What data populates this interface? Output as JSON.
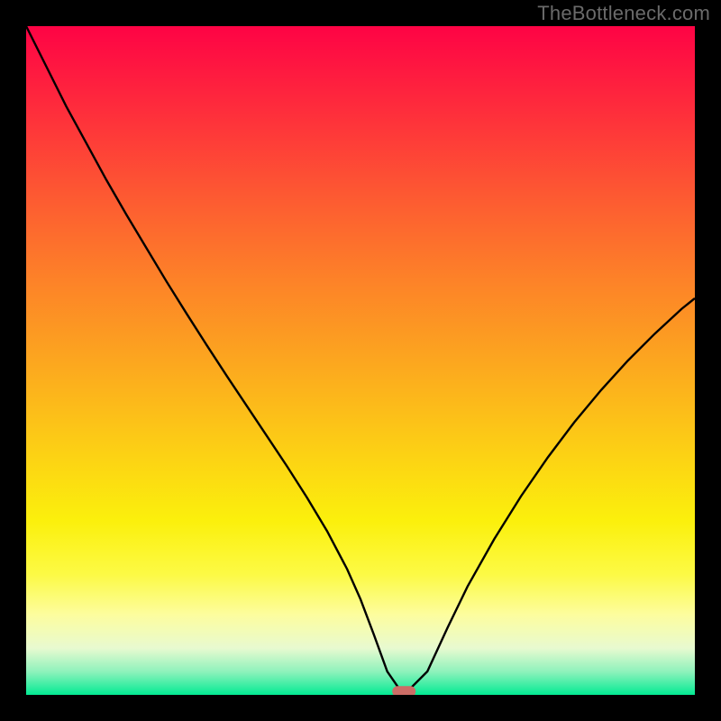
{
  "watermark": "TheBottleneck.com",
  "colors": {
    "frame": "#000000",
    "watermark": "#6a6a6a",
    "curve": "#000000",
    "marker_fill": "#cc6d66",
    "gradient_stops": [
      {
        "offset": 0.0,
        "color": "#fe0345"
      },
      {
        "offset": 0.12,
        "color": "#fe2b3c"
      },
      {
        "offset": 0.25,
        "color": "#fd5832"
      },
      {
        "offset": 0.38,
        "color": "#fd8228"
      },
      {
        "offset": 0.5,
        "color": "#fca61f"
      },
      {
        "offset": 0.62,
        "color": "#fccb16"
      },
      {
        "offset": 0.74,
        "color": "#fbf00c"
      },
      {
        "offset": 0.82,
        "color": "#fcfa45"
      },
      {
        "offset": 0.88,
        "color": "#fdfd9e"
      },
      {
        "offset": 0.93,
        "color": "#e8fad0"
      },
      {
        "offset": 0.965,
        "color": "#8ff2bc"
      },
      {
        "offset": 1.0,
        "color": "#03ea93"
      }
    ]
  },
  "chart_data": {
    "type": "line",
    "title": "",
    "xlabel": "",
    "ylabel": "",
    "xlim": [
      0,
      100
    ],
    "ylim": [
      0,
      100
    ],
    "x": [
      0,
      3,
      6,
      9,
      12,
      15,
      18,
      21,
      24,
      27,
      30,
      33,
      36,
      39,
      42,
      45,
      48,
      50,
      52,
      54,
      56,
      57,
      60,
      63,
      66,
      70,
      74,
      78,
      82,
      86,
      90,
      94,
      98,
      100
    ],
    "values": [
      100,
      94,
      88,
      82.5,
      77,
      71.8,
      66.8,
      61.8,
      57,
      52.3,
      47.7,
      43.2,
      38.7,
      34.2,
      29.5,
      24.5,
      18.8,
      14.3,
      9.0,
      3.5,
      0.6,
      0.5,
      3.5,
      10.0,
      16.2,
      23.3,
      29.7,
      35.5,
      40.8,
      45.6,
      50,
      54,
      57.7,
      59.3
    ],
    "minimum_marker": {
      "x": 56.5,
      "y": 0.5,
      "shape": "rounded-rect"
    }
  }
}
